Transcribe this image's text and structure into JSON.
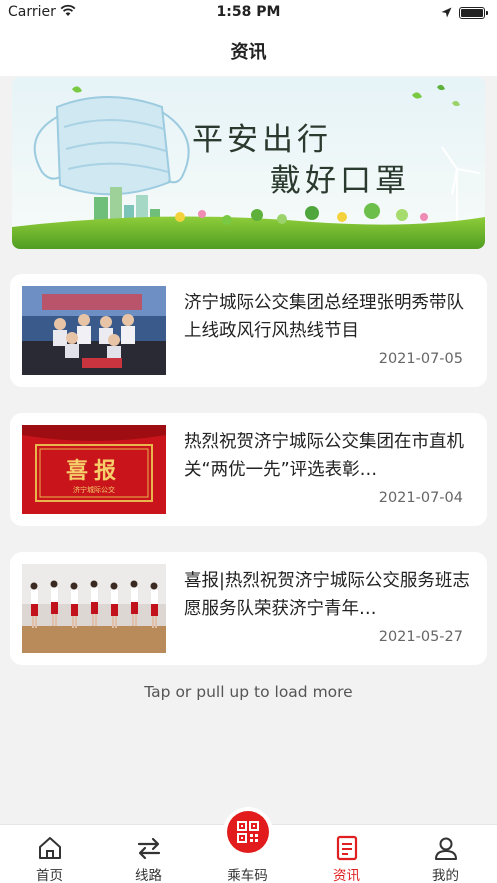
{
  "status_bar": {
    "carrier": "Carrier",
    "time": "1:58 PM"
  },
  "page_title": "资讯",
  "banner": {
    "line1": "平安出行",
    "line2": "戴好口罩"
  },
  "news": [
    {
      "title": "济宁城际公交集团总经理张明秀带队上线政风行风热线节目",
      "date": "2021-07-05"
    },
    {
      "title": "热烈祝贺济宁城际公交集团在市直机关“两优一先”评选表彰…",
      "date": "2021-07-04",
      "thumb_text": "喜报",
      "thumb_subtext": "济宁城际公交"
    },
    {
      "title": "喜报|热烈祝贺济宁城际公交服务班志愿服务队荣获济宁青年…",
      "date": "2021-05-27"
    }
  ],
  "load_more": "Tap or pull up to load more",
  "tabs": [
    {
      "label": "首页",
      "icon": "home-icon"
    },
    {
      "label": "线路",
      "icon": "route-arrows-icon"
    },
    {
      "label": "乘车码",
      "icon": "qr-code-icon"
    },
    {
      "label": "资讯",
      "icon": "news-icon",
      "active": true
    },
    {
      "label": "我的",
      "icon": "user-icon"
    }
  ],
  "colors": {
    "accent": "#e02020",
    "background": "#f2f2f2"
  }
}
